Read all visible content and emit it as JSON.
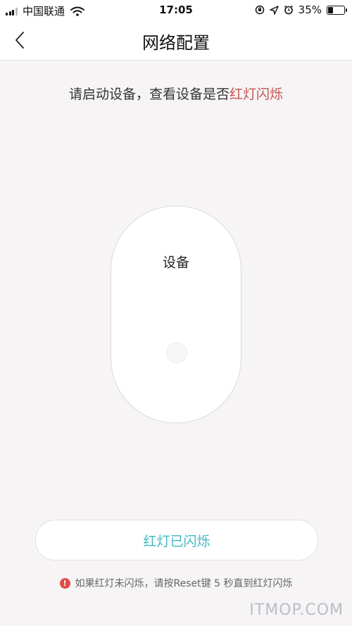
{
  "status_bar": {
    "carrier": "中国联通",
    "time": "17:05",
    "battery_percent": "35%",
    "battery_level": 0.35,
    "icons": [
      "signal-icon",
      "wifi-icon",
      "orientation-lock-icon",
      "location-arrow-icon",
      "alarm-icon",
      "battery-icon"
    ]
  },
  "nav": {
    "title": "网络配置",
    "back_icon": "chevron-left-icon"
  },
  "instruction": {
    "text": "请启动设备，查看设备是否",
    "highlight": "红灯闪烁",
    "highlight_color": "#c6544e"
  },
  "device": {
    "label": "设备"
  },
  "confirm_button": {
    "label": "红灯已闪烁",
    "color": "#3fb8bf"
  },
  "hint": {
    "icon": "exclamation-circle-icon",
    "text": "如果红灯未闪烁，请按Reset键 5 秒直到红灯闪烁",
    "icon_color": "#e24b44"
  },
  "watermark": {
    "text": "ITMOP.COM"
  }
}
